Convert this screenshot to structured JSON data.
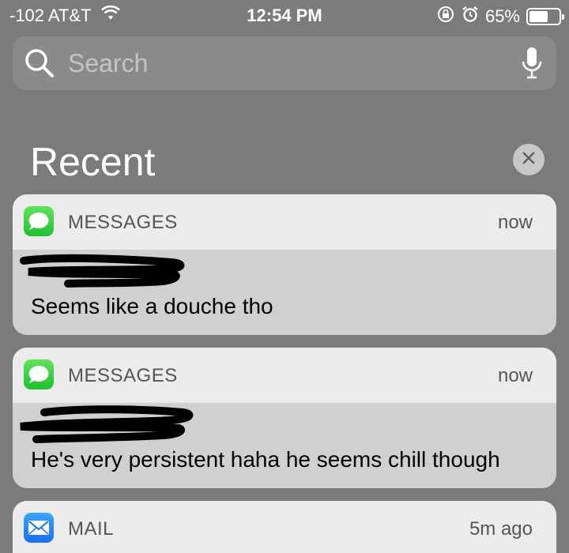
{
  "status_bar": {
    "signal": "-102 AT&T",
    "time": "12:54 PM",
    "battery_percent": "65%",
    "battery_level": 0.65
  },
  "search": {
    "placeholder": "Search"
  },
  "recent": {
    "title": "Recent"
  },
  "notifications": [
    {
      "app": "MESSAGES",
      "time": "now",
      "message": "Seems like a douche tho"
    },
    {
      "app": "MESSAGES",
      "time": "now",
      "message": "He's very persistent haha he seems chill though"
    },
    {
      "app": "MAIL",
      "time": "5m ago",
      "message": ""
    }
  ],
  "colors": {
    "background": "#7b7b7b",
    "card_header": "#ececec",
    "card_body": "#d0d0d0",
    "messages_green": "#34c84a",
    "mail_blue": "#1b6ff0"
  },
  "icons": [
    "wifi-icon",
    "orientation-lock-icon",
    "alarm-icon",
    "battery-icon",
    "search-icon",
    "microphone-icon",
    "close-icon",
    "messages-app-icon",
    "mail-app-icon"
  ]
}
